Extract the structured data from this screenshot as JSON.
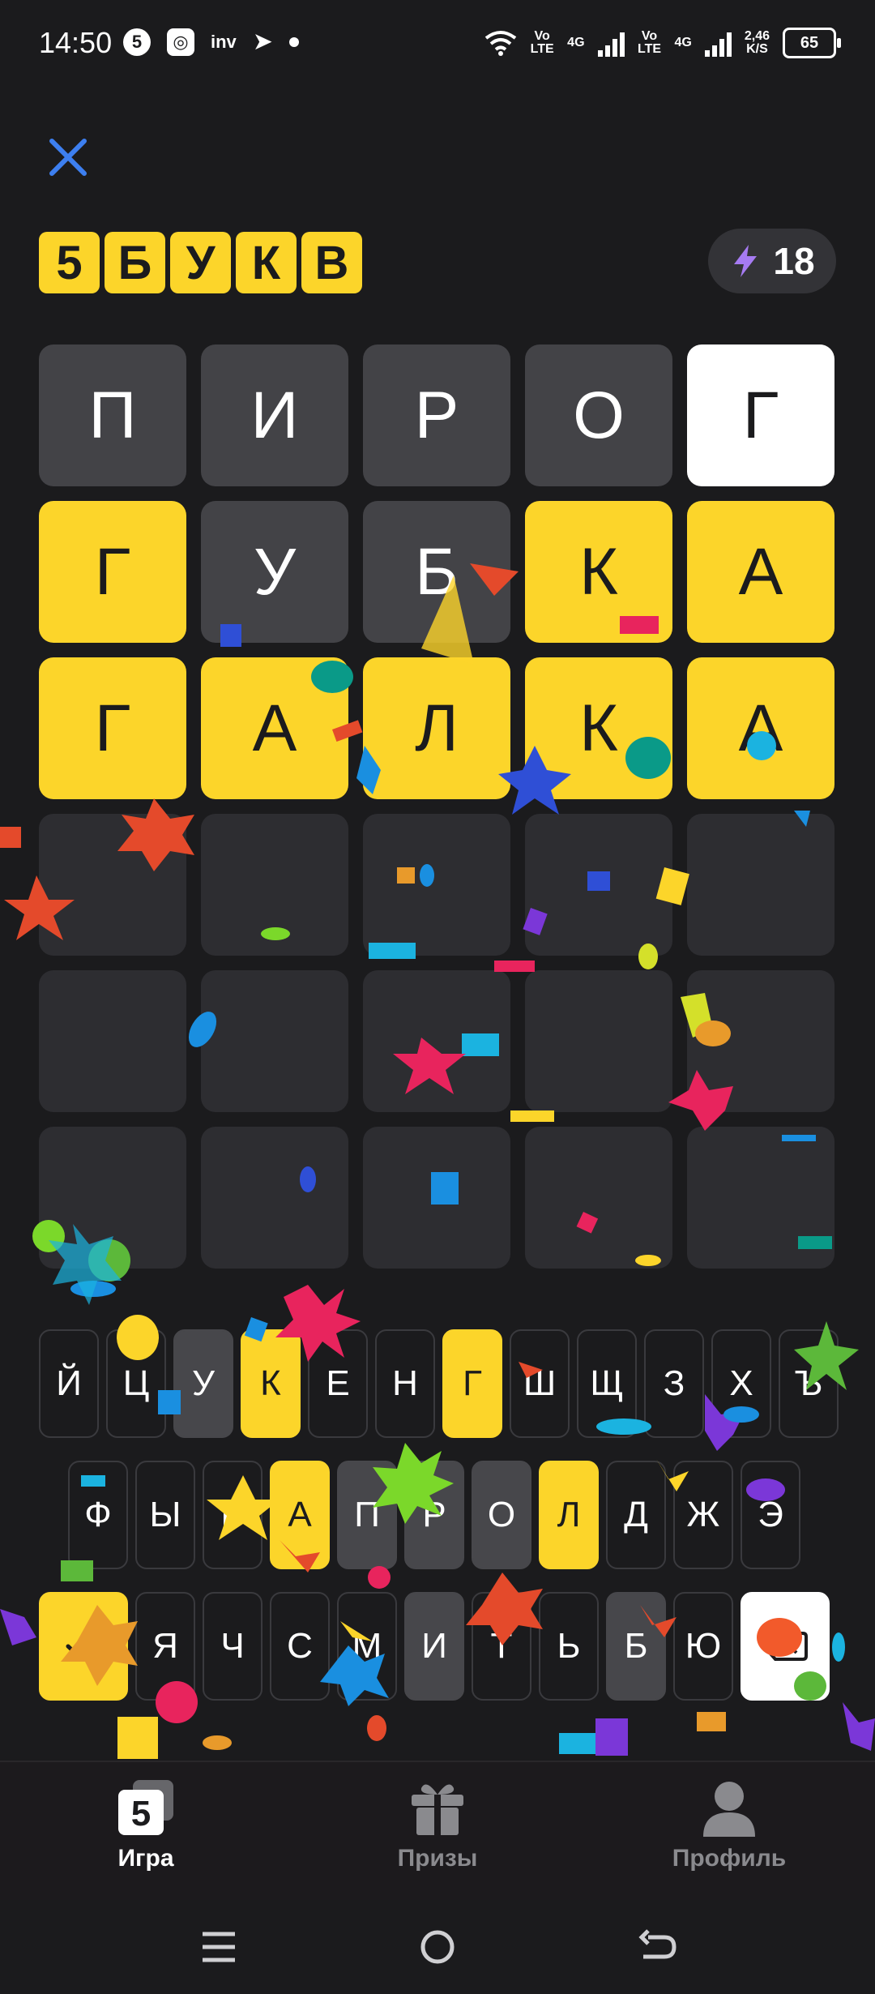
{
  "status_bar": {
    "time": "14:50",
    "left_icons": [
      "5",
      "inv"
    ],
    "network": [
      "Vo LTE",
      "4G",
      "Vo LTE",
      "4G"
    ],
    "speed": "2,46",
    "speed_unit": "K/S",
    "battery": "65"
  },
  "header": {
    "logo_letters": [
      "5",
      "Б",
      "У",
      "К",
      "В"
    ],
    "energy_count": "18"
  },
  "grid": {
    "rows": [
      [
        {
          "l": "П",
          "s": "gray"
        },
        {
          "l": "И",
          "s": "gray"
        },
        {
          "l": "Р",
          "s": "gray"
        },
        {
          "l": "О",
          "s": "gray"
        },
        {
          "l": "Г",
          "s": "white"
        }
      ],
      [
        {
          "l": "Г",
          "s": "yellow"
        },
        {
          "l": "У",
          "s": "gray"
        },
        {
          "l": "Б",
          "s": "gray"
        },
        {
          "l": "К",
          "s": "yellow"
        },
        {
          "l": "А",
          "s": "yellow"
        }
      ],
      [
        {
          "l": "Г",
          "s": "yellow"
        },
        {
          "l": "А",
          "s": "yellow"
        },
        {
          "l": "Л",
          "s": "yellow"
        },
        {
          "l": "К",
          "s": "yellow"
        },
        {
          "l": "А",
          "s": "yellow"
        }
      ],
      [
        {
          "l": "",
          "s": "empty"
        },
        {
          "l": "",
          "s": "empty"
        },
        {
          "l": "",
          "s": "empty"
        },
        {
          "l": "",
          "s": "empty"
        },
        {
          "l": "",
          "s": "empty"
        }
      ],
      [
        {
          "l": "",
          "s": "empty"
        },
        {
          "l": "",
          "s": "empty"
        },
        {
          "l": "",
          "s": "empty"
        },
        {
          "l": "",
          "s": "empty"
        },
        {
          "l": "",
          "s": "empty"
        }
      ],
      [
        {
          "l": "",
          "s": "empty"
        },
        {
          "l": "",
          "s": "empty"
        },
        {
          "l": "",
          "s": "empty"
        },
        {
          "l": "",
          "s": "empty"
        },
        {
          "l": "",
          "s": "empty"
        }
      ]
    ]
  },
  "keyboard": {
    "row1": [
      {
        "k": "Й",
        "s": ""
      },
      {
        "k": "Ц",
        "s": ""
      },
      {
        "k": "У",
        "s": "gray"
      },
      {
        "k": "К",
        "s": "yellow"
      },
      {
        "k": "Е",
        "s": ""
      },
      {
        "k": "Н",
        "s": ""
      },
      {
        "k": "Г",
        "s": "yellow"
      },
      {
        "k": "Ш",
        "s": ""
      },
      {
        "k": "Щ",
        "s": ""
      },
      {
        "k": "З",
        "s": ""
      },
      {
        "k": "Х",
        "s": ""
      },
      {
        "k": "Ъ",
        "s": ""
      }
    ],
    "row2": [
      {
        "k": "Ф",
        "s": ""
      },
      {
        "k": "Ы",
        "s": ""
      },
      {
        "k": "В",
        "s": ""
      },
      {
        "k": "А",
        "s": "yellow"
      },
      {
        "k": "П",
        "s": "gray"
      },
      {
        "k": "Р",
        "s": "gray"
      },
      {
        "k": "О",
        "s": "gray"
      },
      {
        "k": "Л",
        "s": "yellow"
      },
      {
        "k": "Д",
        "s": ""
      },
      {
        "k": "Ж",
        "s": ""
      },
      {
        "k": "Э",
        "s": ""
      }
    ],
    "row3": [
      {
        "k": "Я",
        "s": ""
      },
      {
        "k": "Ч",
        "s": ""
      },
      {
        "k": "С",
        "s": ""
      },
      {
        "k": "М",
        "s": ""
      },
      {
        "k": "И",
        "s": "gray"
      },
      {
        "k": "Т",
        "s": ""
      },
      {
        "k": "Ь",
        "s": ""
      },
      {
        "k": "Б",
        "s": "gray"
      },
      {
        "k": "Ю",
        "s": ""
      }
    ],
    "enter_icon": "check-icon",
    "backspace_icon": "backspace-icon"
  },
  "bottom_nav": {
    "items": [
      {
        "label": "Игра",
        "icon": "game-icon",
        "active": true,
        "icon_text": "5"
      },
      {
        "label": "Призы",
        "icon": "gift-icon",
        "active": false
      },
      {
        "label": "Профиль",
        "icon": "profile-icon",
        "active": false
      }
    ]
  },
  "colors": {
    "yellow": "#fcd52a",
    "gray_tile": "#434347",
    "empty_tile": "#2d2d31",
    "background": "#1b1b1d",
    "close_icon": "#3d7ff0"
  }
}
